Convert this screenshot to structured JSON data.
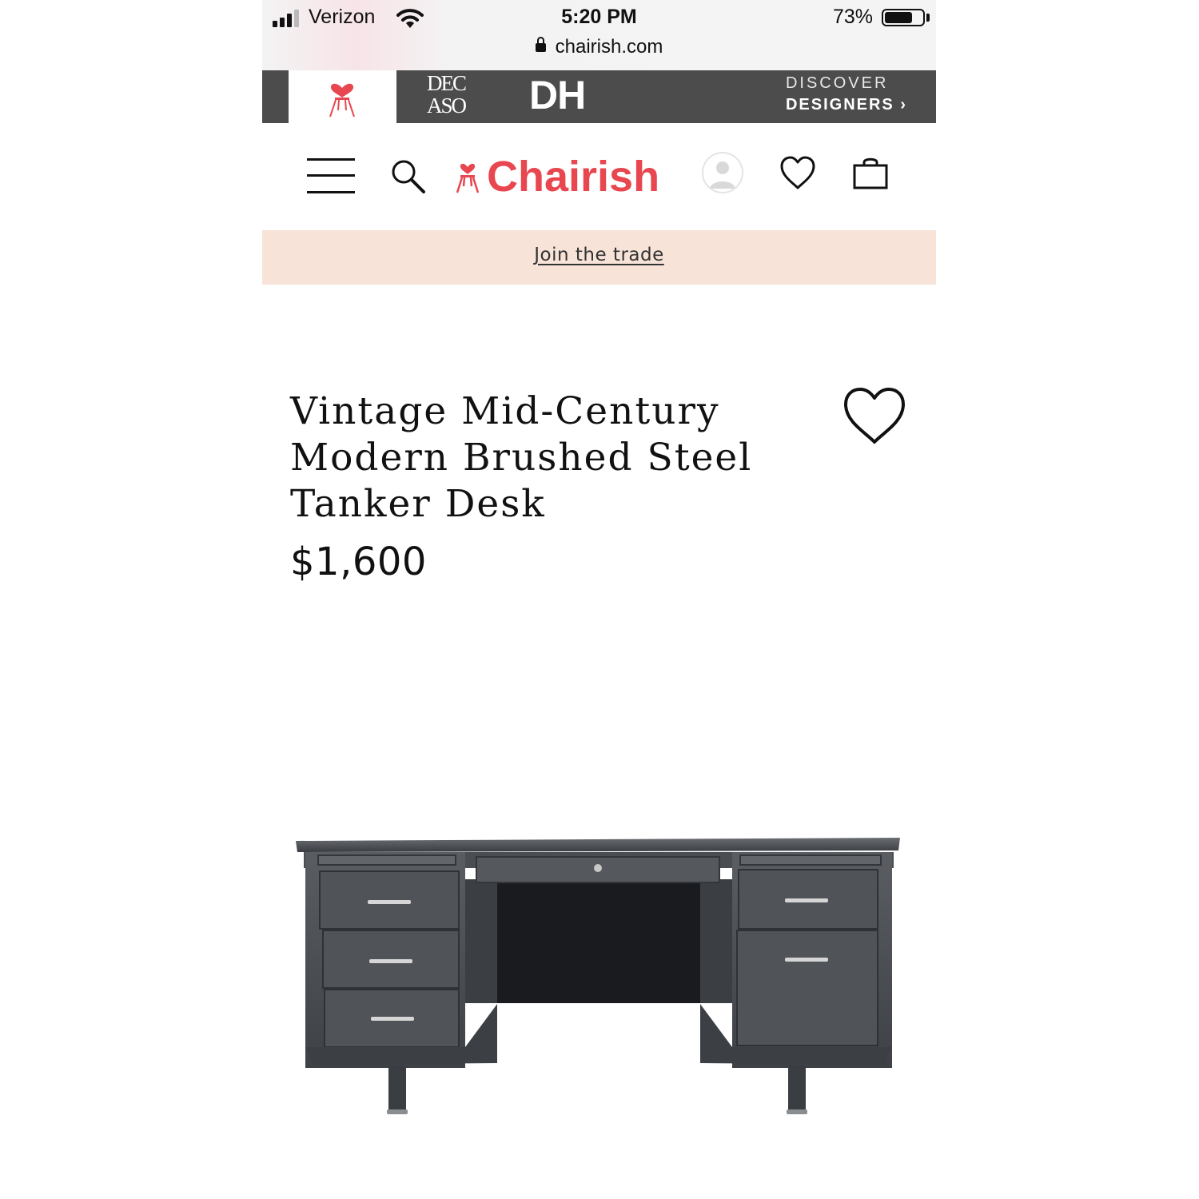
{
  "status_bar": {
    "carrier": "Verizon",
    "time": "5:20 PM",
    "battery_percent": "73%",
    "battery_level": 0.73,
    "url": "chairish.com"
  },
  "brand_bar": {
    "decaso_line1": "DEC",
    "decaso_line2": "ASO",
    "dh": "DH",
    "discover_line1": "DISCOVER",
    "discover_line2": "DESIGNERS ›"
  },
  "nav": {
    "logo_text": "Chairish"
  },
  "trade": {
    "link_text": "Join the trade"
  },
  "product": {
    "title": "Vintage Mid-Century Modern Brushed Steel Tanker Desk",
    "price": "$1,600"
  },
  "colors": {
    "brand_red": "#e8474f",
    "brand_bar": "#4c4c4c",
    "trade_banner": "#f8e3d8"
  }
}
